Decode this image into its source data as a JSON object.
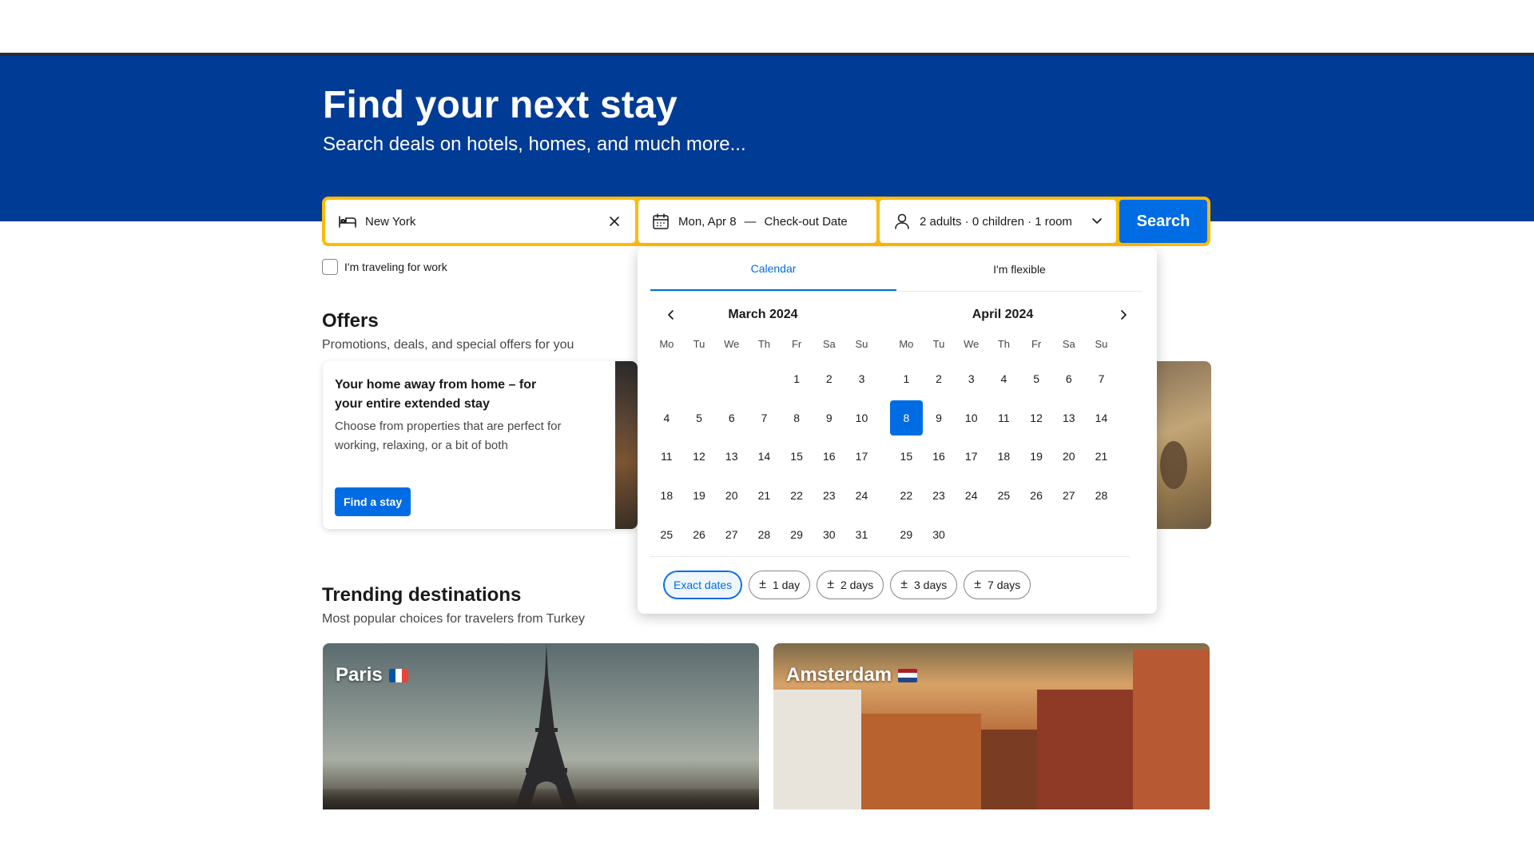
{
  "hero": {
    "title": "Find your next stay",
    "subtitle": "Search deals on hotels, homes, and much more..."
  },
  "search": {
    "destination_value": "New York",
    "checkin": "Mon, Apr 8",
    "separator": "—",
    "checkout_placeholder": "Check-out Date",
    "guests": "2 adults · 0 children · 1 room",
    "search_label": "Search"
  },
  "work_travel": {
    "label": "I'm traveling for work",
    "checked": false
  },
  "offers": {
    "title": "Offers",
    "subtitle": "Promotions, deals, and special offers for you",
    "card": {
      "heading": "Your home away from home – for your entire extended stay",
      "body": "Choose from properties that are perfect for working, relaxing, or a bit of both",
      "button": "Find a stay"
    }
  },
  "calendar": {
    "tabs": [
      "Calendar",
      "I'm flexible"
    ],
    "active_tab": "Calendar",
    "weekdays": [
      "Mo",
      "Tu",
      "We",
      "Th",
      "Fr",
      "Sa",
      "Su"
    ],
    "months": [
      {
        "title": "March 2024",
        "offset": 4,
        "days": 31
      },
      {
        "title": "April 2024",
        "offset": 0,
        "days": 30
      }
    ],
    "selected": {
      "month": "April 2024",
      "day": 8
    },
    "chips": [
      {
        "label": "Exact dates",
        "plusminus": false,
        "active": true
      },
      {
        "label": "1 day",
        "plusminus": true,
        "active": false
      },
      {
        "label": "2 days",
        "plusminus": true,
        "active": false
      },
      {
        "label": "3 days",
        "plusminus": true,
        "active": false
      },
      {
        "label": "7 days",
        "plusminus": true,
        "active": false
      }
    ]
  },
  "trending": {
    "title": "Trending destinations",
    "subtitle": "Most popular choices for travelers from Turkey",
    "destinations": [
      {
        "name": "Paris",
        "flag": "fr-flag-icon"
      },
      {
        "name": "Amsterdam",
        "flag": "nl-flag-icon"
      }
    ]
  },
  "colors": {
    "brand_blue": "#003b95",
    "action_blue": "#006ce4",
    "search_border": "#febb02"
  }
}
